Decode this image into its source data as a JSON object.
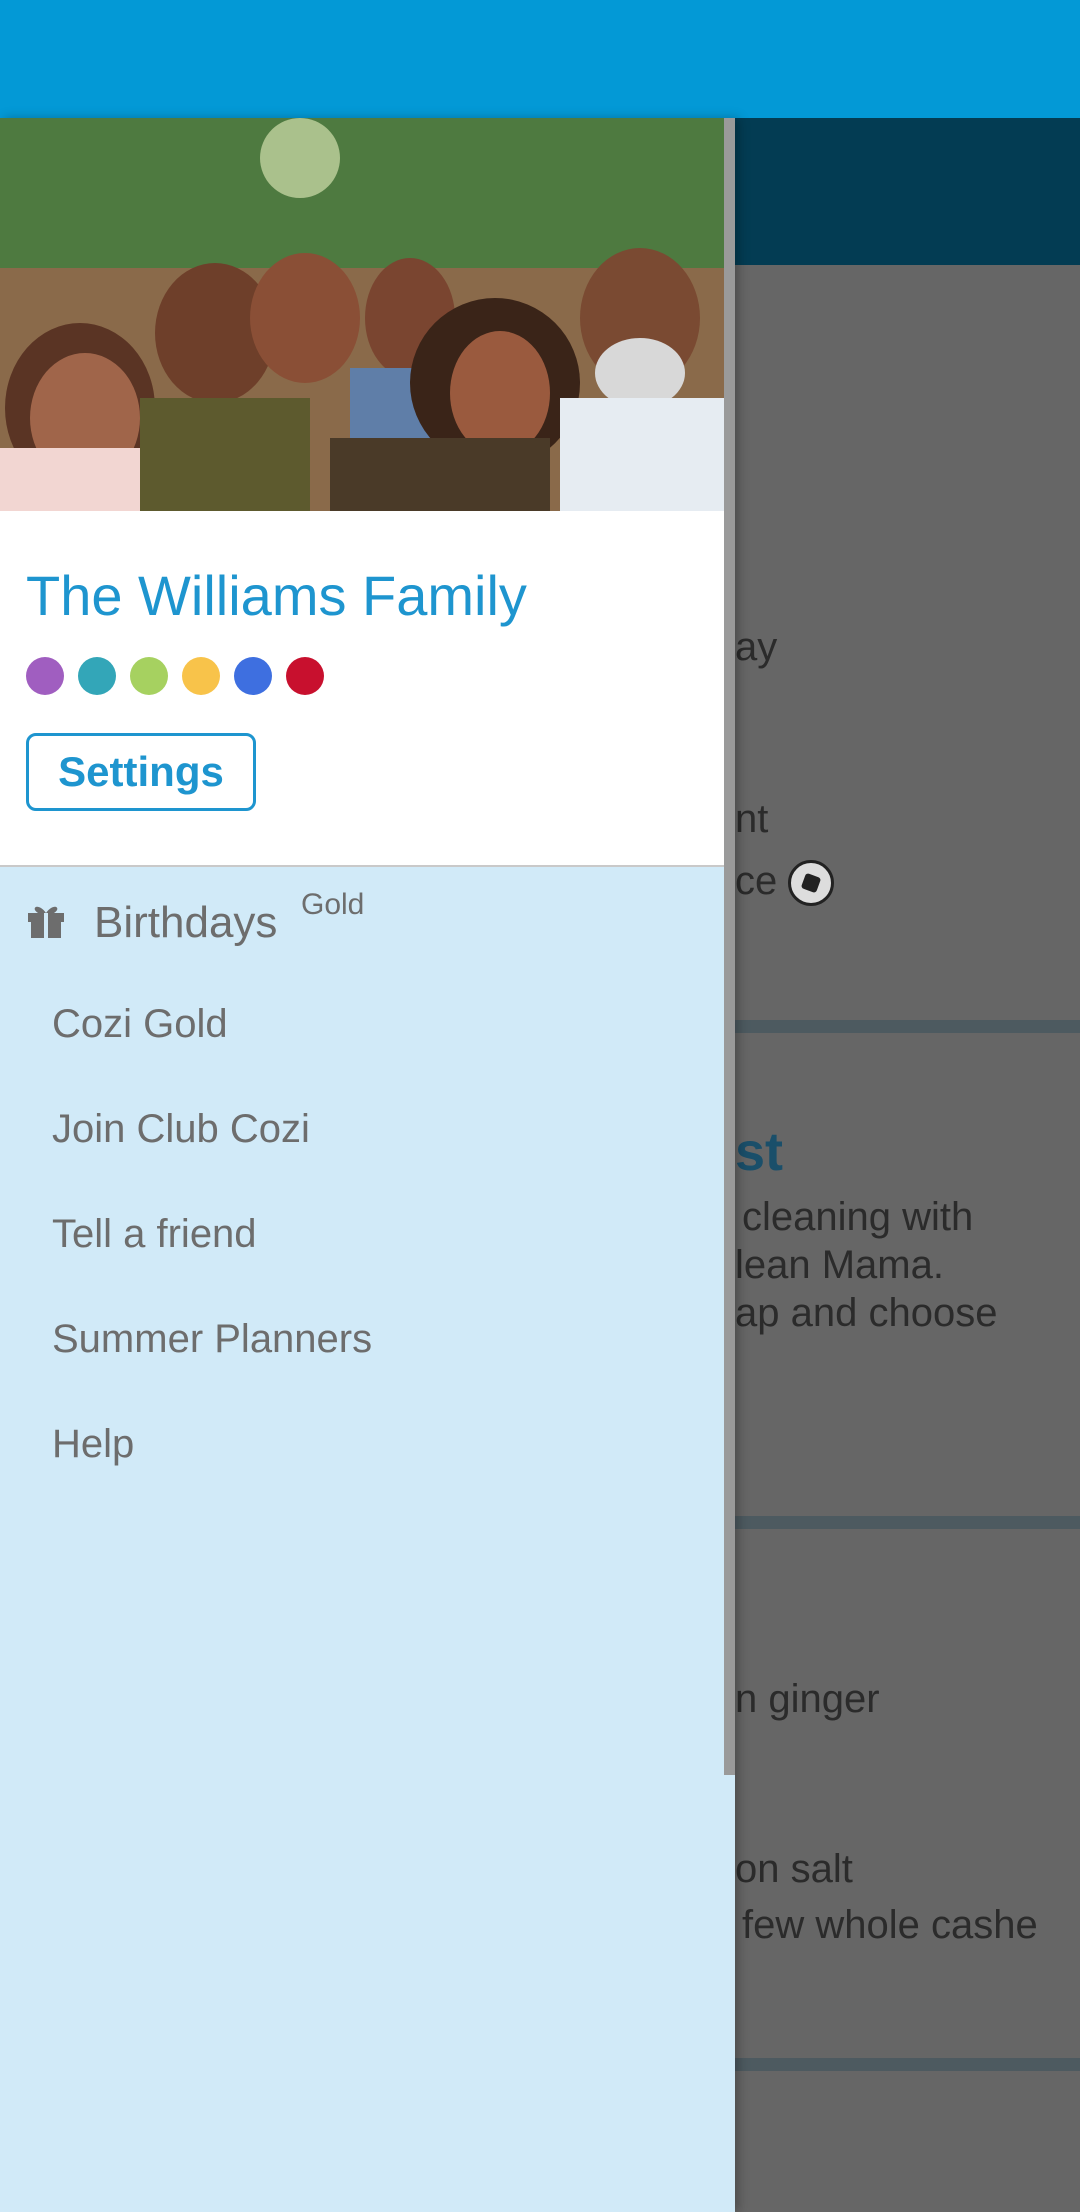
{
  "background": {
    "snippets": [
      {
        "text": "ay"
      },
      {
        "text": "nt"
      },
      {
        "text": "ce"
      },
      {
        "text": "st"
      },
      {
        "text": "cleaning with"
      },
      {
        "text": "lean Mama."
      },
      {
        "text": "ap and choose"
      },
      {
        "text": "n ginger"
      },
      {
        "text": "on salt"
      },
      {
        "text": "few whole cashe"
      }
    ]
  },
  "drawer": {
    "family_name": "The Williams Family",
    "member_colors": [
      "#a05ec0",
      "#33a6b8",
      "#a6d160",
      "#f8c34a",
      "#3e6fe0",
      "#c8102e"
    ],
    "settings_label": "Settings",
    "birthdays": {
      "label": "Birthdays",
      "badge": "Gold",
      "icon": "gift-icon"
    },
    "menu_items": [
      {
        "label": "Cozi Gold"
      },
      {
        "label": "Join Club Cozi"
      },
      {
        "label": "Tell a friend"
      },
      {
        "label": "Summer Planners"
      },
      {
        "label": "Help"
      }
    ]
  },
  "colors": {
    "status_bar": "#0399d6",
    "toolbar": "#033c53",
    "accent": "#1e95cf",
    "drawer_bg": "#d1eaf8"
  }
}
